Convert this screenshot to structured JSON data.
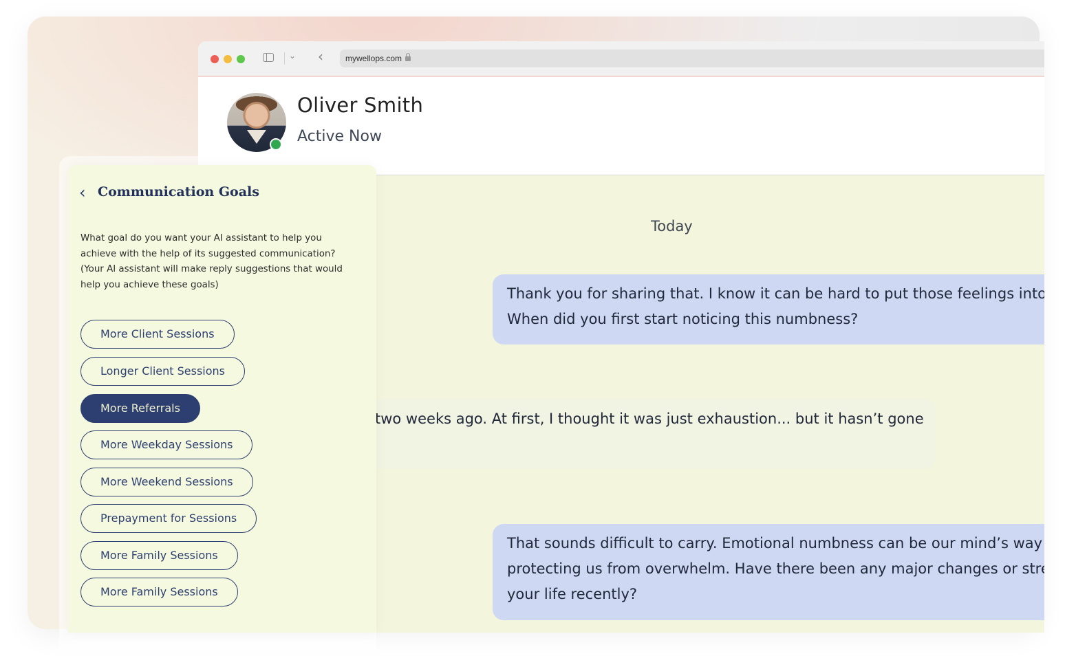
{
  "browser": {
    "url": "mywellops.com"
  },
  "contact": {
    "name": "Oliver Smith",
    "status": "Active Now"
  },
  "chat": {
    "date_separator": "Today",
    "messages": [
      {
        "direction": "out",
        "lines": [
          "Thank you for sharing that. I know it can be hard to put those feelings into",
          "When did you first start noticing this numbness?"
        ]
      },
      {
        "direction": "in",
        "lines": [
          "two weeks ago. At first, I thought it was just exhaustion... but it hasn’t gone"
        ]
      },
      {
        "direction": "out",
        "lines": [
          "That sounds difficult to carry. Emotional numbness can be our mind’s way",
          "protecting us from overwhelm. Have there been any major changes or stre",
          "your life recently?"
        ]
      }
    ]
  },
  "goals_panel": {
    "title": "Communication Goals",
    "description": "What goal do you want your AI assistant to help you achieve with the help of its suggested communication? (Your AI assistant will make reply suggestions that would help you achieve these goals)",
    "options": [
      {
        "label": "More Client Sessions",
        "selected": false
      },
      {
        "label": "Longer Client Sessions",
        "selected": false
      },
      {
        "label": "More Referrals",
        "selected": true
      },
      {
        "label": "More Weekday Sessions",
        "selected": false
      },
      {
        "label": "More Weekend Sessions",
        "selected": false
      },
      {
        "label": "Prepayment for Sessions",
        "selected": false
      },
      {
        "label": "More Family Sessions",
        "selected": false
      },
      {
        "label": "More Family Sessions",
        "selected": false
      }
    ]
  },
  "colors": {
    "accent": "#2d3f70",
    "outgoing_bubble": "#cfd8f3",
    "panel_bg": "#f5f9df",
    "online": "#2fa84f"
  }
}
